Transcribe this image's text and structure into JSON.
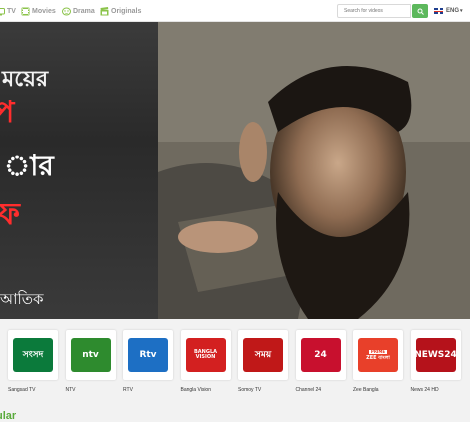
{
  "nav": {
    "items": [
      {
        "label": "TV",
        "icon": "tv-icon"
      },
      {
        "label": "Movies",
        "icon": "film-icon"
      },
      {
        "label": "Drama",
        "icon": "mask-icon"
      },
      {
        "label": "Originals",
        "icon": "clapper-icon"
      }
    ],
    "search": {
      "placeholder": "Search for videos",
      "icon": "search-icon"
    },
    "language": {
      "label": "ENG",
      "icon": "uk-flag-icon",
      "caret": "▾"
    }
  },
  "hero": {
    "title_lines": [
      "ময়ের",
      "প",
      "ার",
      "ফ"
    ],
    "credit": "আতিক",
    "slide_count": 4,
    "active_slide": 4
  },
  "channels": [
    {
      "name": "Sangsad TV",
      "logo_text": "সংসদ",
      "color": "#0b7a3b"
    },
    {
      "name": "NTV",
      "logo_text": "ntv",
      "color": "#2e8b2e"
    },
    {
      "name": "RTV",
      "logo_text": "Rtv",
      "color": "#1d6fc4"
    },
    {
      "name": "Bangla Vision",
      "logo_text": "BANGLA VISION",
      "color": "#d32020"
    },
    {
      "name": "Somoy TV",
      "logo_text": "সময়",
      "color": "#c01818"
    },
    {
      "name": "Channel 24",
      "logo_text": "24",
      "color": "#c8102e"
    },
    {
      "name": "Zee Bangla",
      "logo_text": "ZEE বাংলা",
      "badge": "PRIME",
      "color": "#e8402a"
    },
    {
      "name": "News 24 HD",
      "logo_text": "NEWS24",
      "color": "#b5121b"
    }
  ],
  "section": {
    "title": "ular"
  },
  "colors": {
    "accent": "#5cb85c",
    "active_dot": "#3aa63a"
  }
}
